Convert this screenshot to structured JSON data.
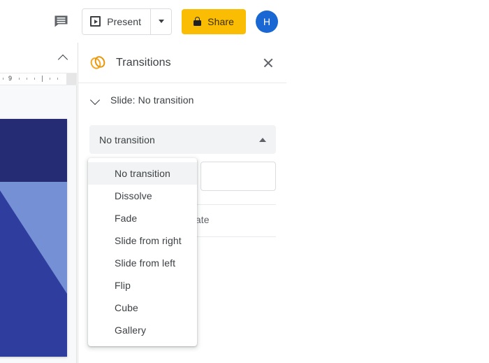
{
  "toolbar": {
    "comment_icon": "comment-icon",
    "present": {
      "label": "Present",
      "play_icon": "present-play-icon",
      "caret_icon": "chevron-down-icon"
    },
    "share": {
      "label": "Share",
      "lock_icon": "lock-icon",
      "color": "#fbbc04"
    },
    "avatar": {
      "initial": "H",
      "color": "#1967d2"
    }
  },
  "editor": {
    "collapse_icon": "chevron-up-icon",
    "ruler": {
      "number": "9"
    },
    "slide": {
      "color_top": "#262c73",
      "color_mid": "#7590d4",
      "color_diag": "#2f3e9e"
    }
  },
  "panel": {
    "icon": "transitions-icon",
    "title": "Transitions",
    "close_icon": "close-icon",
    "section": {
      "expand_icon": "chevron-down-icon",
      "label": "Slide: No transition"
    },
    "select": {
      "value": "No transition",
      "caret_icon": "chevron-up-icon"
    },
    "hint": "Select an object to animate"
  },
  "dropdown": {
    "selected": "No transition",
    "items": [
      {
        "label": "No transition"
      },
      {
        "label": "Dissolve"
      },
      {
        "label": "Fade"
      },
      {
        "label": "Slide from right"
      },
      {
        "label": "Slide from left"
      },
      {
        "label": "Flip"
      },
      {
        "label": "Cube"
      },
      {
        "label": "Gallery"
      }
    ]
  }
}
